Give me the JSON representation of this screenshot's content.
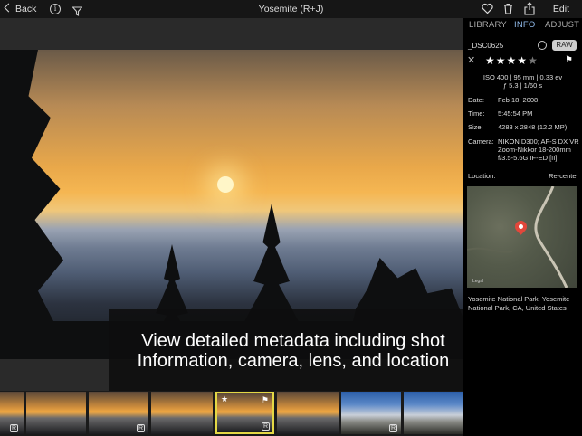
{
  "topbar": {
    "back_label": "Back",
    "info_icon": "i",
    "title": "Yosemite (R+J)",
    "edit_label": "Edit"
  },
  "caption": {
    "line1": "View detailed metadata including shot",
    "line2": "Information, camera, lens, and location"
  },
  "panel": {
    "tabs": [
      "LIBRARY",
      "INFO",
      "ADJUST"
    ],
    "active_tab": "INFO",
    "filename": "_DSC0625",
    "raw_badge": "RAW",
    "reject_icon": "✕",
    "rating": 4,
    "max_rating": 5,
    "exif_line1": "ISO 400 | 95 mm | 0.33 ev",
    "exif_line2": "ƒ 5.3 | 1/60 s",
    "rows": [
      {
        "label": "Date:",
        "value": "Feb 18, 2008"
      },
      {
        "label": "Time:",
        "value": "5:45:54 PM"
      },
      {
        "label": "Size:",
        "value": "4288 x 2848 (12.2 MP)"
      },
      {
        "label": "Camera:",
        "value": "NIKON D300; AF-S DX VR Zoom-Nikkor 18-200mm f/3.5-5.6G IF-ED [II]"
      }
    ],
    "location_label": "Location:",
    "recenter_label": "Re-center",
    "map_legal": "Legal",
    "place": "Yosemite National Park, Yosemite National Park, CA, United States"
  },
  "filmstrip": {
    "badge": "R",
    "star": "★",
    "flag": "⚑"
  },
  "colors": {
    "accent": "#8fb8e8",
    "selection": "#e4d845",
    "pin": "#e2473b"
  }
}
